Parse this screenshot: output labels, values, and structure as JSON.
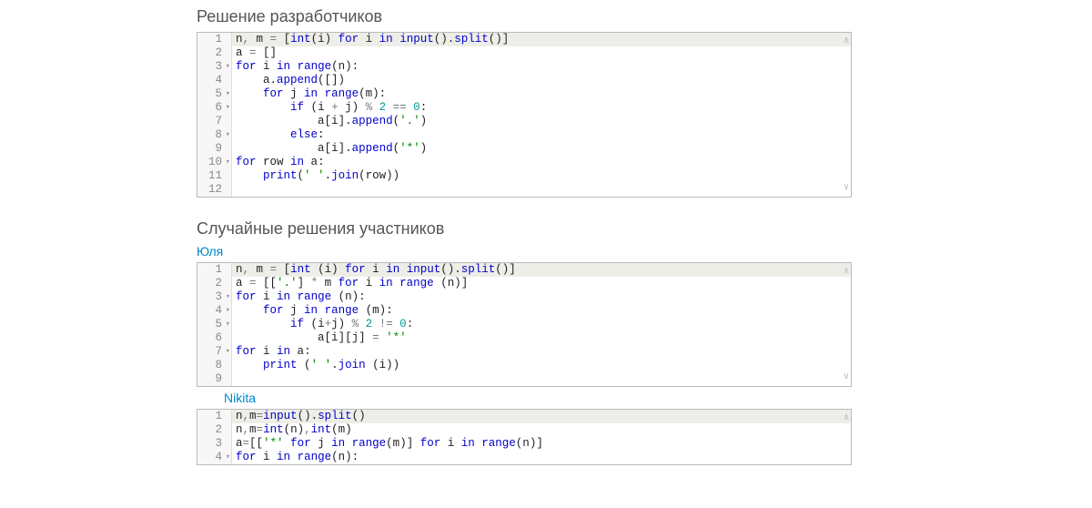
{
  "sections": {
    "developers": {
      "title": "Решение разработчиков"
    },
    "participants": {
      "title": "Случайные решения участников"
    }
  },
  "users": {
    "u1": {
      "name": "Юля"
    },
    "u2": {
      "name": "Nikita"
    }
  },
  "blocks": [
    {
      "id": "dev",
      "lines": [
        {
          "n": "1",
          "hl": true,
          "fold": false,
          "tokens": [
            [
              "id",
              "n"
            ],
            [
              "op",
              ", "
            ],
            [
              "id",
              "m"
            ],
            [
              "op",
              " = "
            ],
            [
              "punc",
              "["
            ],
            [
              "fn",
              "int"
            ],
            [
              "punc",
              "("
            ],
            [
              "id",
              "i"
            ],
            [
              "punc",
              ") "
            ],
            [
              "kw",
              "for"
            ],
            [
              "id",
              " i "
            ],
            [
              "kw",
              "in"
            ],
            [
              "id",
              " "
            ],
            [
              "fn",
              "input"
            ],
            [
              "punc",
              "()."
            ],
            [
              "fn",
              "split"
            ],
            [
              "punc",
              "()]"
            ]
          ]
        },
        {
          "n": "2",
          "hl": false,
          "fold": false,
          "tokens": [
            [
              "id",
              "a"
            ],
            [
              "op",
              " = "
            ],
            [
              "punc",
              "[]"
            ]
          ]
        },
        {
          "n": "3",
          "hl": false,
          "fold": true,
          "tokens": [
            [
              "kw",
              "for"
            ],
            [
              "id",
              " i "
            ],
            [
              "kw",
              "in"
            ],
            [
              "id",
              " "
            ],
            [
              "fn",
              "range"
            ],
            [
              "punc",
              "("
            ],
            [
              "id",
              "n"
            ],
            [
              "punc",
              "):"
            ]
          ]
        },
        {
          "n": "4",
          "hl": false,
          "fold": false,
          "tokens": [
            [
              "id",
              "    a"
            ],
            [
              "punc",
              "."
            ],
            [
              "fn",
              "append"
            ],
            [
              "punc",
              "([])"
            ]
          ]
        },
        {
          "n": "5",
          "hl": false,
          "fold": true,
          "tokens": [
            [
              "id",
              "    "
            ],
            [
              "kw",
              "for"
            ],
            [
              "id",
              " j "
            ],
            [
              "kw",
              "in"
            ],
            [
              "id",
              " "
            ],
            [
              "fn",
              "range"
            ],
            [
              "punc",
              "("
            ],
            [
              "id",
              "m"
            ],
            [
              "punc",
              "):"
            ]
          ]
        },
        {
          "n": "6",
          "hl": false,
          "fold": true,
          "tokens": [
            [
              "id",
              "        "
            ],
            [
              "kw",
              "if"
            ],
            [
              "id",
              " "
            ],
            [
              "punc",
              "("
            ],
            [
              "id",
              "i"
            ],
            [
              "op",
              " + "
            ],
            [
              "id",
              "j"
            ],
            [
              "punc",
              ") "
            ],
            [
              "op",
              "% "
            ],
            [
              "num",
              "2"
            ],
            [
              "op",
              " == "
            ],
            [
              "num",
              "0"
            ],
            [
              "punc",
              ":"
            ]
          ]
        },
        {
          "n": "7",
          "hl": false,
          "fold": false,
          "tokens": [
            [
              "id",
              "            a"
            ],
            [
              "punc",
              "["
            ],
            [
              "id",
              "i"
            ],
            [
              "punc",
              "]."
            ],
            [
              "fn",
              "append"
            ],
            [
              "punc",
              "("
            ],
            [
              "str",
              "'.'"
            ],
            [
              "punc",
              ")"
            ]
          ]
        },
        {
          "n": "8",
          "hl": false,
          "fold": true,
          "tokens": [
            [
              "id",
              "        "
            ],
            [
              "kw",
              "else"
            ],
            [
              "punc",
              ":"
            ]
          ]
        },
        {
          "n": "9",
          "hl": false,
          "fold": false,
          "tokens": [
            [
              "id",
              "            a"
            ],
            [
              "punc",
              "["
            ],
            [
              "id",
              "i"
            ],
            [
              "punc",
              "]."
            ],
            [
              "fn",
              "append"
            ],
            [
              "punc",
              "("
            ],
            [
              "str",
              "'*'"
            ],
            [
              "punc",
              ")"
            ]
          ]
        },
        {
          "n": "10",
          "hl": false,
          "fold": true,
          "tokens": [
            [
              "kw",
              "for"
            ],
            [
              "id",
              " row "
            ],
            [
              "kw",
              "in"
            ],
            [
              "id",
              " a"
            ],
            [
              "punc",
              ":"
            ]
          ]
        },
        {
          "n": "11",
          "hl": false,
          "fold": false,
          "tokens": [
            [
              "id",
              "    "
            ],
            [
              "fn",
              "print"
            ],
            [
              "punc",
              "("
            ],
            [
              "str",
              "' '"
            ],
            [
              "punc",
              "."
            ],
            [
              "fn",
              "join"
            ],
            [
              "punc",
              "("
            ],
            [
              "id",
              "row"
            ],
            [
              "punc",
              "))"
            ]
          ]
        },
        {
          "n": "12",
          "hl": false,
          "fold": false,
          "tokens": []
        }
      ]
    },
    {
      "id": "u1",
      "lines": [
        {
          "n": "1",
          "hl": true,
          "fold": false,
          "tokens": [
            [
              "id",
              "n"
            ],
            [
              "op",
              ", "
            ],
            [
              "id",
              "m"
            ],
            [
              "op",
              " = "
            ],
            [
              "punc",
              "["
            ],
            [
              "fn",
              "int"
            ],
            [
              "id",
              " "
            ],
            [
              "punc",
              "("
            ],
            [
              "id",
              "i"
            ],
            [
              "punc",
              ") "
            ],
            [
              "kw",
              "for"
            ],
            [
              "id",
              " i "
            ],
            [
              "kw",
              "in"
            ],
            [
              "id",
              " "
            ],
            [
              "fn",
              "input"
            ],
            [
              "punc",
              "()."
            ],
            [
              "fn",
              "split"
            ],
            [
              "punc",
              "()]"
            ]
          ]
        },
        {
          "n": "2",
          "hl": false,
          "fold": false,
          "tokens": [
            [
              "id",
              "a"
            ],
            [
              "op",
              " = "
            ],
            [
              "punc",
              "[["
            ],
            [
              "str",
              "'.'"
            ],
            [
              "punc",
              "] "
            ],
            [
              "op",
              "* "
            ],
            [
              "id",
              "m "
            ],
            [
              "kw",
              "for"
            ],
            [
              "id",
              " i "
            ],
            [
              "kw",
              "in"
            ],
            [
              "id",
              " "
            ],
            [
              "fn",
              "range"
            ],
            [
              "id",
              " "
            ],
            [
              "punc",
              "("
            ],
            [
              "id",
              "n"
            ],
            [
              "punc",
              ")]"
            ]
          ]
        },
        {
          "n": "3",
          "hl": false,
          "fold": true,
          "tokens": [
            [
              "kw",
              "for"
            ],
            [
              "id",
              " i "
            ],
            [
              "kw",
              "in"
            ],
            [
              "id",
              " "
            ],
            [
              "fn",
              "range"
            ],
            [
              "id",
              " "
            ],
            [
              "punc",
              "("
            ],
            [
              "id",
              "n"
            ],
            [
              "punc",
              "):"
            ]
          ]
        },
        {
          "n": "4",
          "hl": false,
          "fold": true,
          "tokens": [
            [
              "id",
              "    "
            ],
            [
              "kw",
              "for"
            ],
            [
              "id",
              " j "
            ],
            [
              "kw",
              "in"
            ],
            [
              "id",
              " "
            ],
            [
              "fn",
              "range"
            ],
            [
              "id",
              " "
            ],
            [
              "punc",
              "("
            ],
            [
              "id",
              "m"
            ],
            [
              "punc",
              "):"
            ]
          ]
        },
        {
          "n": "5",
          "hl": false,
          "fold": true,
          "tokens": [
            [
              "id",
              "        "
            ],
            [
              "kw",
              "if"
            ],
            [
              "id",
              " "
            ],
            [
              "punc",
              "("
            ],
            [
              "id",
              "i"
            ],
            [
              "op",
              "+"
            ],
            [
              "id",
              "j"
            ],
            [
              "punc",
              ") "
            ],
            [
              "op",
              "% "
            ],
            [
              "num",
              "2"
            ],
            [
              "op",
              " != "
            ],
            [
              "num",
              "0"
            ],
            [
              "punc",
              ":"
            ]
          ]
        },
        {
          "n": "6",
          "hl": false,
          "fold": false,
          "tokens": [
            [
              "id",
              "            a"
            ],
            [
              "punc",
              "["
            ],
            [
              "id",
              "i"
            ],
            [
              "punc",
              "]["
            ],
            [
              "id",
              "j"
            ],
            [
              "punc",
              "]"
            ],
            [
              "op",
              " = "
            ],
            [
              "str",
              "'*'"
            ]
          ]
        },
        {
          "n": "7",
          "hl": false,
          "fold": true,
          "tokens": [
            [
              "kw",
              "for"
            ],
            [
              "id",
              " i "
            ],
            [
              "kw",
              "in"
            ],
            [
              "id",
              " a"
            ],
            [
              "punc",
              ":"
            ]
          ]
        },
        {
          "n": "8",
          "hl": false,
          "fold": false,
          "tokens": [
            [
              "id",
              "    "
            ],
            [
              "fn",
              "print"
            ],
            [
              "id",
              " "
            ],
            [
              "punc",
              "("
            ],
            [
              "str",
              "' '"
            ],
            [
              "punc",
              "."
            ],
            [
              "fn",
              "join"
            ],
            [
              "id",
              " "
            ],
            [
              "punc",
              "("
            ],
            [
              "id",
              "i"
            ],
            [
              "punc",
              "))"
            ]
          ]
        },
        {
          "n": "9",
          "hl": false,
          "fold": false,
          "tokens": []
        }
      ]
    },
    {
      "id": "u2",
      "lines": [
        {
          "n": "1",
          "hl": true,
          "fold": false,
          "tokens": [
            [
              "id",
              "n"
            ],
            [
              "op",
              ","
            ],
            [
              "id",
              "m"
            ],
            [
              "op",
              "="
            ],
            [
              "fn",
              "input"
            ],
            [
              "punc",
              "()."
            ],
            [
              "fn",
              "split"
            ],
            [
              "punc",
              "()"
            ]
          ]
        },
        {
          "n": "2",
          "hl": false,
          "fold": false,
          "tokens": [
            [
              "id",
              "n"
            ],
            [
              "op",
              ","
            ],
            [
              "id",
              "m"
            ],
            [
              "op",
              "="
            ],
            [
              "fn",
              "int"
            ],
            [
              "punc",
              "("
            ],
            [
              "id",
              "n"
            ],
            [
              "punc",
              ")"
            ],
            [
              "op",
              ","
            ],
            [
              "fn",
              "int"
            ],
            [
              "punc",
              "("
            ],
            [
              "id",
              "m"
            ],
            [
              "punc",
              ")"
            ]
          ]
        },
        {
          "n": "3",
          "hl": false,
          "fold": false,
          "tokens": [
            [
              "id",
              "a"
            ],
            [
              "op",
              "="
            ],
            [
              "punc",
              "[["
            ],
            [
              "str",
              "'*'"
            ],
            [
              "id",
              " "
            ],
            [
              "kw",
              "for"
            ],
            [
              "id",
              " j "
            ],
            [
              "kw",
              "in"
            ],
            [
              "id",
              " "
            ],
            [
              "fn",
              "range"
            ],
            [
              "punc",
              "("
            ],
            [
              "id",
              "m"
            ],
            [
              "punc",
              ")] "
            ],
            [
              "kw",
              "for"
            ],
            [
              "id",
              " i "
            ],
            [
              "kw",
              "in"
            ],
            [
              "id",
              " "
            ],
            [
              "fn",
              "range"
            ],
            [
              "punc",
              "("
            ],
            [
              "id",
              "n"
            ],
            [
              "punc",
              ")]"
            ]
          ]
        },
        {
          "n": "4",
          "hl": false,
          "fold": true,
          "tokens": [
            [
              "kw",
              "for"
            ],
            [
              "id",
              " i "
            ],
            [
              "kw",
              "in"
            ],
            [
              "id",
              " "
            ],
            [
              "fn",
              "range"
            ],
            [
              "punc",
              "("
            ],
            [
              "id",
              "n"
            ],
            [
              "punc",
              "):"
            ]
          ]
        }
      ]
    }
  ]
}
